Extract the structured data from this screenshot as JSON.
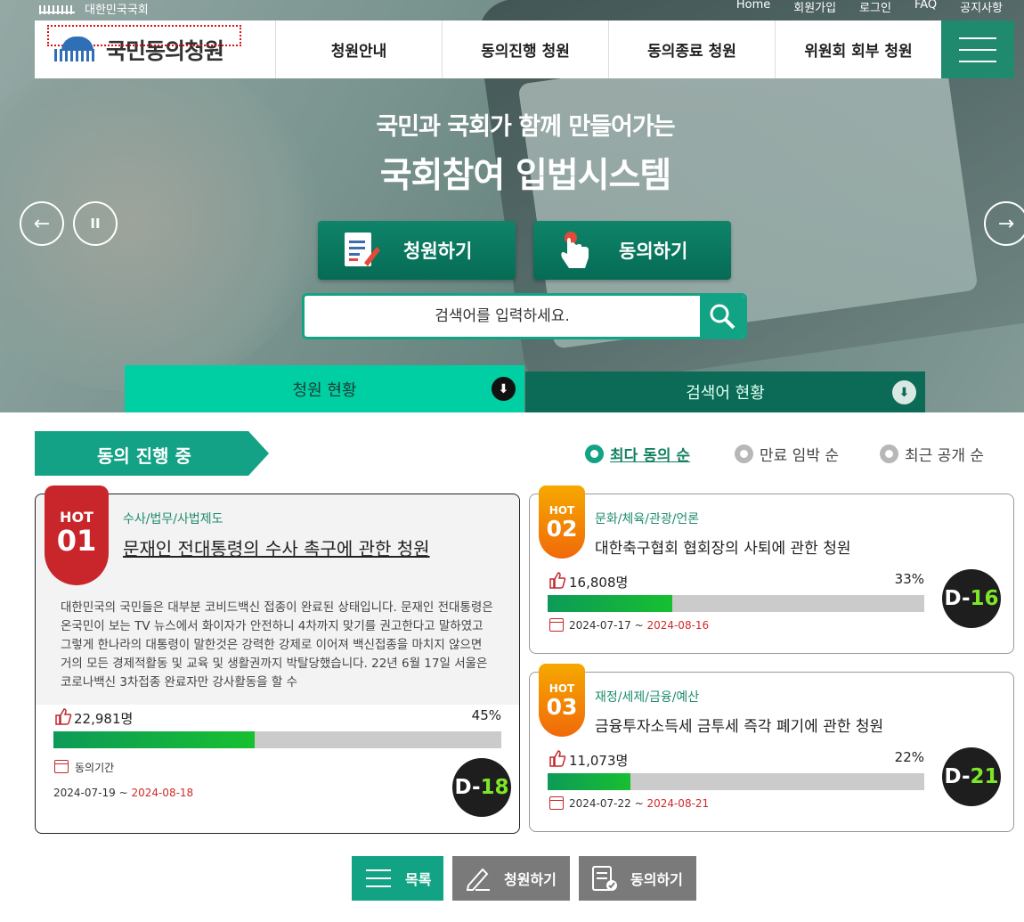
{
  "topbar": {
    "assembly": "대한민국국회",
    "util": [
      "Home",
      "회원가입",
      "로그인",
      "FAQ",
      "공지사항"
    ]
  },
  "gnb": {
    "logo": "국민동의청원",
    "menu": [
      "청원안내",
      "동의진행 청원",
      "동의종료 청원",
      "위원회 회부 청원"
    ]
  },
  "hero": {
    "subtitle": "국민과 국회가 함께 만들어가는",
    "title": "국회참여 입법시스템",
    "prev": "←",
    "pause": "II",
    "next": "→"
  },
  "cta": {
    "petition": "청원하기",
    "agree": "동의하기"
  },
  "search": {
    "placeholder": "검색어를 입력하세요."
  },
  "tabs": {
    "status": "청원 현황",
    "keyword": "검색어 현황"
  },
  "section": {
    "title": "동의 진행 중",
    "sort": [
      "최다 동의 순",
      "만료 임박 순",
      "최근 공개 순"
    ]
  },
  "petitions": [
    {
      "hot": "HOT",
      "rank": "01",
      "category": "수사/법무/사법제도",
      "title": "문재인 전대통령의 수사 촉구에 관한 청원",
      "desc": "대한민국의 국민들은 대부분 코비드백신 접종이 완료된 상태입니다. 문재인 전대통령은 온국민이 보는 TV 뉴스에서 화이자가 안전하니 4차까지 맞기를 권고한다고 말하였고 그렇게 한나라의 대통령이 말한것은 강력한 강제로 이어져 백신접종을 마치지 않으면 거의 모든 경제적활동 및 교육 및 생활권까지 박탈당했습니다. 22년 6월 17일 서울은 코로나백신 3차접종 완료자만 강사활동을 할 수",
      "count": "22,981명",
      "percent": "45%",
      "progress": 45,
      "period_label": "동의기간",
      "start": "2024-07-19",
      "sep": " ~ ",
      "end": "2024-08-18",
      "dday_prefix": "D-",
      "dday_num": "18"
    },
    {
      "hot": "HOT",
      "rank": "02",
      "category": "문화/체육/관광/언론",
      "title": "대한축구협회 협회장의 사퇴에 관한 청원",
      "count": "16,808명",
      "percent": "33%",
      "progress": 33,
      "start": "2024-07-17",
      "sep": " ~ ",
      "end": "2024-08-16",
      "dday_prefix": "D-",
      "dday_num": "16"
    },
    {
      "hot": "HOT",
      "rank": "03",
      "category": "재정/세제/금융/예산",
      "title": "금융투자소득세 금투세 즉각 폐기에 관한 청원",
      "count": "11,073명",
      "percent": "22%",
      "progress": 22,
      "start": "2024-07-22",
      "sep": " ~ ",
      "end": "2024-08-21",
      "dday_prefix": "D-",
      "dday_num": "21"
    }
  ],
  "bottom": {
    "list": "목록",
    "petition": "청원하기",
    "agree": "동의하기"
  }
}
